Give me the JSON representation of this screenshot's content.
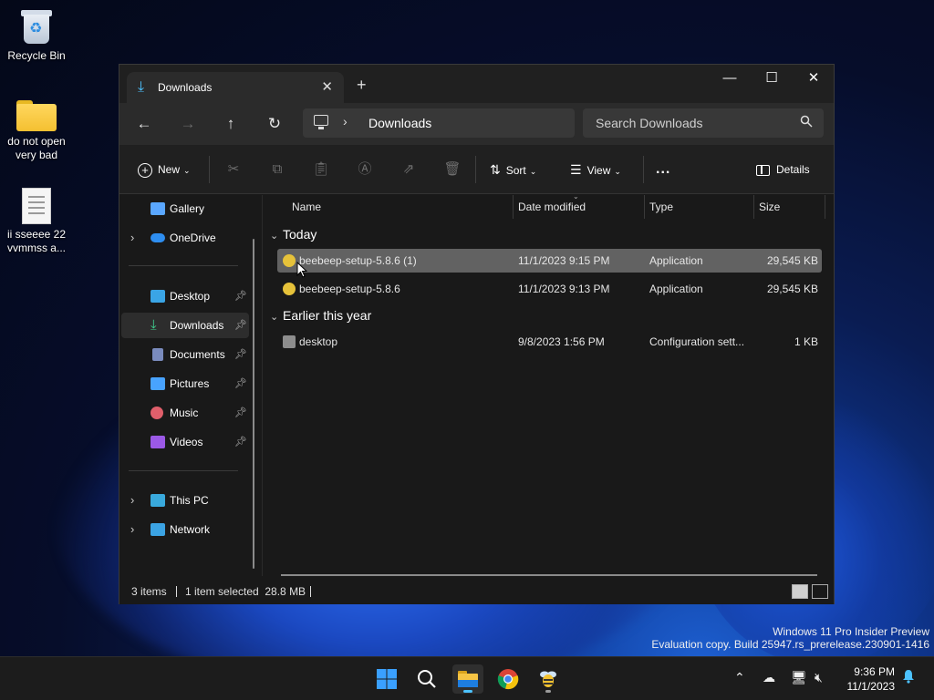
{
  "desktop": {
    "icons": [
      {
        "label": "Recycle Bin"
      },
      {
        "label": "do not open very bad"
      },
      {
        "label": "ii  sseeee  22 vvmmss  a..."
      }
    ]
  },
  "window": {
    "tab_title": "Downloads",
    "new_tab_label": "+",
    "address_crumb": "Downloads",
    "search_placeholder": "Search Downloads",
    "commands": {
      "new_label": "New",
      "sort_label": "Sort",
      "view_label": "View",
      "more_label": "...",
      "details_label": "Details"
    },
    "sidebar": {
      "items": [
        {
          "label": "Gallery",
          "icon": "gallery-icon",
          "color": "#5aa7ff"
        },
        {
          "label": "OneDrive",
          "icon": "onedrive-icon",
          "color": "#2e8ef0"
        },
        {
          "label": "Desktop",
          "icon": "desktop-icon",
          "color": "#3aa5e6"
        },
        {
          "label": "Downloads",
          "icon": "download-icon",
          "color": "#3fcf8e"
        },
        {
          "label": "Documents",
          "icon": "documents-icon",
          "color": "#7a8bbd"
        },
        {
          "label": "Pictures",
          "icon": "pictures-icon",
          "color": "#48a3ff"
        },
        {
          "label": "Music",
          "icon": "music-icon",
          "color": "#e05f6b"
        },
        {
          "label": "Videos",
          "icon": "videos-icon",
          "color": "#9b59e6"
        },
        {
          "label": "This PC",
          "icon": "this-pc-icon",
          "color": "#39a9dc"
        },
        {
          "label": "Network",
          "icon": "network-icon",
          "color": "#3ba3e3"
        }
      ]
    },
    "columns": {
      "name": "Name",
      "date": "Date modified",
      "type": "Type",
      "size": "Size"
    },
    "groups": [
      {
        "title": "Today",
        "files": [
          {
            "name": "beebeep-setup-5.8.6 (1)",
            "date": "11/1/2023 9:15 PM",
            "type": "Application",
            "size": "29,545 KB"
          },
          {
            "name": "beebeep-setup-5.8.6",
            "date": "11/1/2023 9:13 PM",
            "type": "Application",
            "size": "29,545 KB"
          }
        ]
      },
      {
        "title": "Earlier this year",
        "files": [
          {
            "name": "desktop",
            "date": "9/8/2023 1:56 PM",
            "type": "Configuration sett...",
            "size": "1 KB"
          }
        ]
      }
    ],
    "status": {
      "items": "3 items",
      "selection": "1 item selected  28.8 MB"
    }
  },
  "watermark": {
    "line1": "Windows 11 Pro Insider Preview",
    "line2": "Evaluation copy. Build 25947.rs_prerelease.230901-1416"
  },
  "taskbar": {
    "time": "9:36 PM",
    "date": "11/1/2023"
  },
  "colors": {
    "accent": "#4cc2ff",
    "selection": "#626262",
    "window_bg": "#191919"
  }
}
